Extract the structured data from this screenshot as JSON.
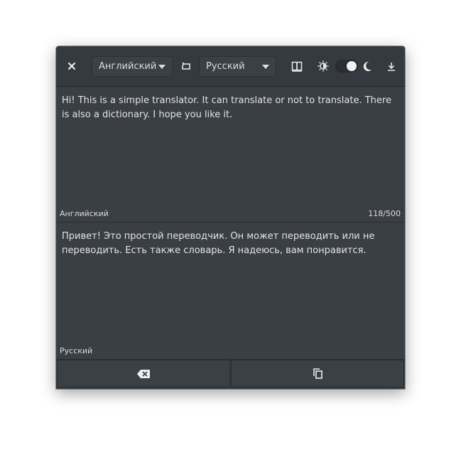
{
  "header": {
    "source_language": "Английский",
    "target_language": "Русский",
    "icons": {
      "close": "close-icon",
      "swap": "swap-languages-icon",
      "dictionary": "book-icon",
      "light": "sun-icon",
      "dark": "moon-icon",
      "download": "download-icon"
    },
    "dark_mode_enabled": true
  },
  "source_pane": {
    "text": "Hi! This is a simple translator. It can translate or not to translate. There is also a dictionary. I hope you like it.",
    "language_label": "Английский",
    "char_count": "118/500"
  },
  "target_pane": {
    "text": "Привет! Это простой переводчик. Он может переводить или не переводить. Есть также словарь. Я надеюсь, вам понравится.",
    "language_label": "Русский"
  },
  "footer": {
    "clear_icon": "backspace-clear-icon",
    "copy_icon": "copy-icon"
  }
}
